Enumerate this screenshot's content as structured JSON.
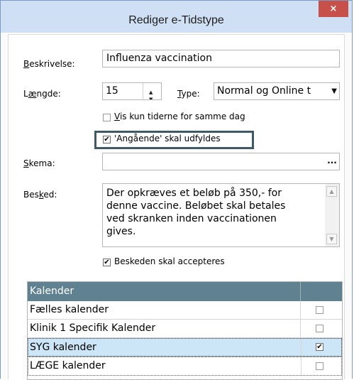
{
  "window": {
    "title": "Rediger e-Tidstype",
    "close_glyph": "×"
  },
  "form": {
    "beskrivelse": {
      "label_u": "B",
      "label_rest": "eskrivelse:",
      "value": "Influenza vaccination"
    },
    "laengde": {
      "label_pre": "L",
      "label_u": "æ",
      "label_rest": "ngde:",
      "value": "15"
    },
    "type": {
      "label_u": "T",
      "label_rest": "ype:",
      "value": "Normal og Online t"
    },
    "vis_kun": {
      "label_u": "V",
      "label_rest": "is kun tiderne for samme dag",
      "checked": false
    },
    "angaende": {
      "label": "'Angående' skal udfyldes",
      "checked": true
    },
    "skema": {
      "label_u": "S",
      "label_rest": "kema:",
      "value": "",
      "button": "..."
    },
    "besked": {
      "label_pre": "Bes",
      "label_u": "k",
      "label_rest": "ed:",
      "text": "Der opkræves et beløb på 350,- for\ndenne vaccine. Beløbet skal betales\nved skranken inden vaccinationen\ngives."
    },
    "accepteres": {
      "label": "Beskeden skal accepteres",
      "checked": true
    }
  },
  "table": {
    "header": "Kalender",
    "rows": [
      {
        "label": "Fælles kalender",
        "checked": false,
        "selected": false
      },
      {
        "label": "Klinik 1 Specifik Kalender",
        "checked": false,
        "selected": false
      },
      {
        "label": "SYG kalender",
        "checked": true,
        "selected": true
      },
      {
        "label": "LÆGE kalender",
        "checked": false,
        "selected": false
      }
    ]
  },
  "icons": {
    "check": "✔",
    "spin_up": "▲",
    "spin_down": "▼",
    "dropdown": "▼",
    "scroll_up": "▲",
    "scroll_down": "▼"
  },
  "colors": {
    "titlebar": "#cfe0f4",
    "close": "#c7504a",
    "table_header": "#5f8190",
    "selected_row": "#cde6f7",
    "highlight_border": "#3f5966"
  }
}
